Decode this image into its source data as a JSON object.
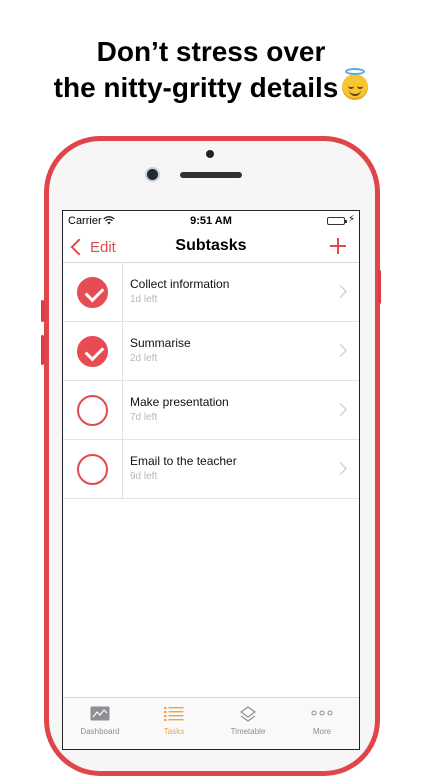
{
  "headline": {
    "line1": "Don’t stress over",
    "line2": "the nitty-gritty details"
  },
  "status_bar": {
    "carrier": "Carrier",
    "time": "9:51 AM"
  },
  "nav": {
    "back_label": "Edit",
    "title": "Subtasks"
  },
  "subtasks": [
    {
      "title": "Collect information",
      "due": "1d left",
      "done": true
    },
    {
      "title": "Summarise",
      "due": "2d left",
      "done": true
    },
    {
      "title": "Make presentation",
      "due": "7d left",
      "done": false
    },
    {
      "title": "Email to the teacher",
      "due": "9d left",
      "done": false
    }
  ],
  "tabs": [
    {
      "label": "Dashboard",
      "icon": "dashboard-icon"
    },
    {
      "label": "Tasks",
      "icon": "tasks-icon",
      "active": true
    },
    {
      "label": "Timetable",
      "icon": "timetable-icon"
    },
    {
      "label": "More",
      "icon": "more-icon"
    }
  ],
  "colors": {
    "accent": "#e04b4f",
    "active_tab": "#f3a14a",
    "phone_frame": "#e0454a"
  }
}
